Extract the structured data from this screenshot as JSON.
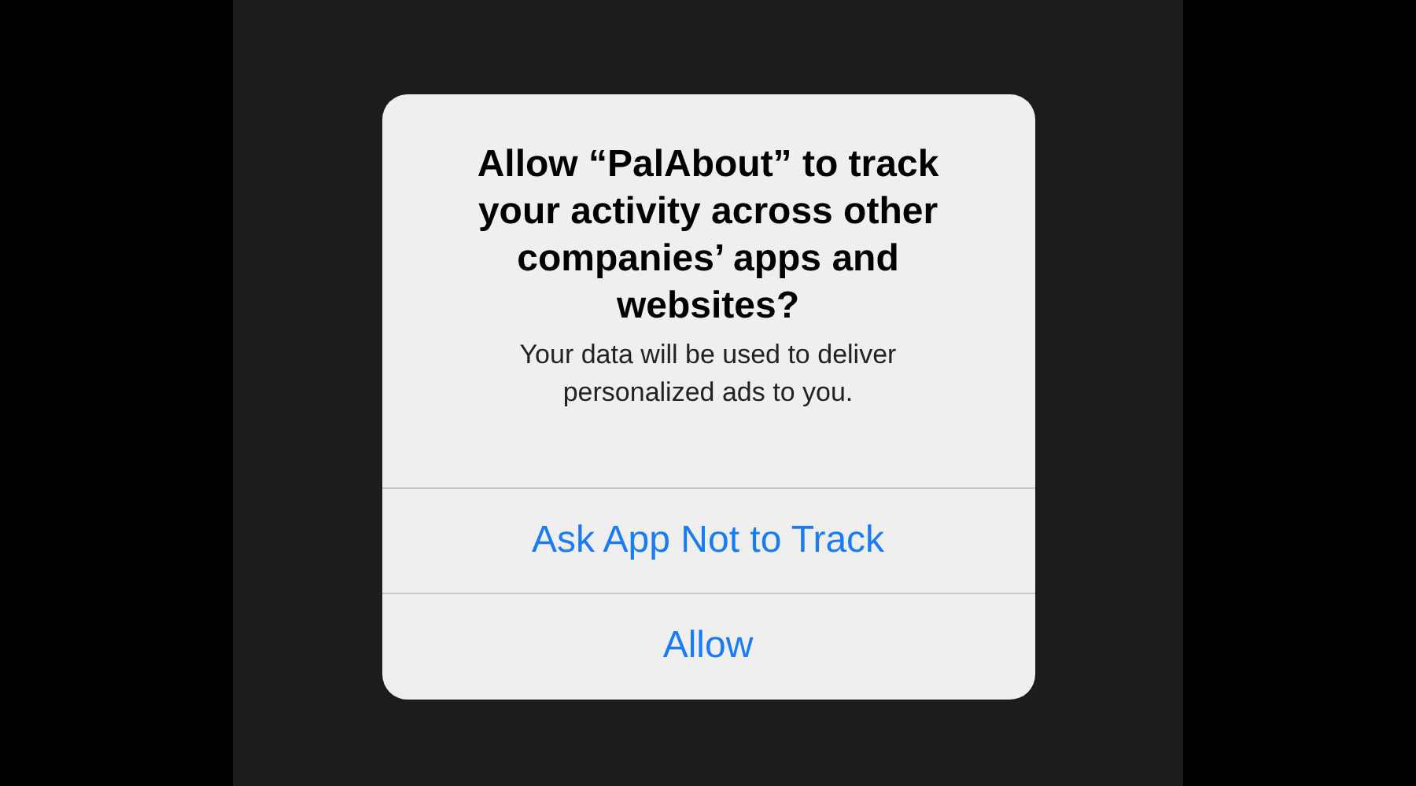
{
  "alert": {
    "title": "Allow “PalAbout” to track your activity across other companies’ apps and websites?",
    "message": "Your data will be used to deliver personalized ads to you.",
    "buttons": [
      {
        "label": "Ask App Not to Track"
      },
      {
        "label": "Allow"
      }
    ]
  }
}
